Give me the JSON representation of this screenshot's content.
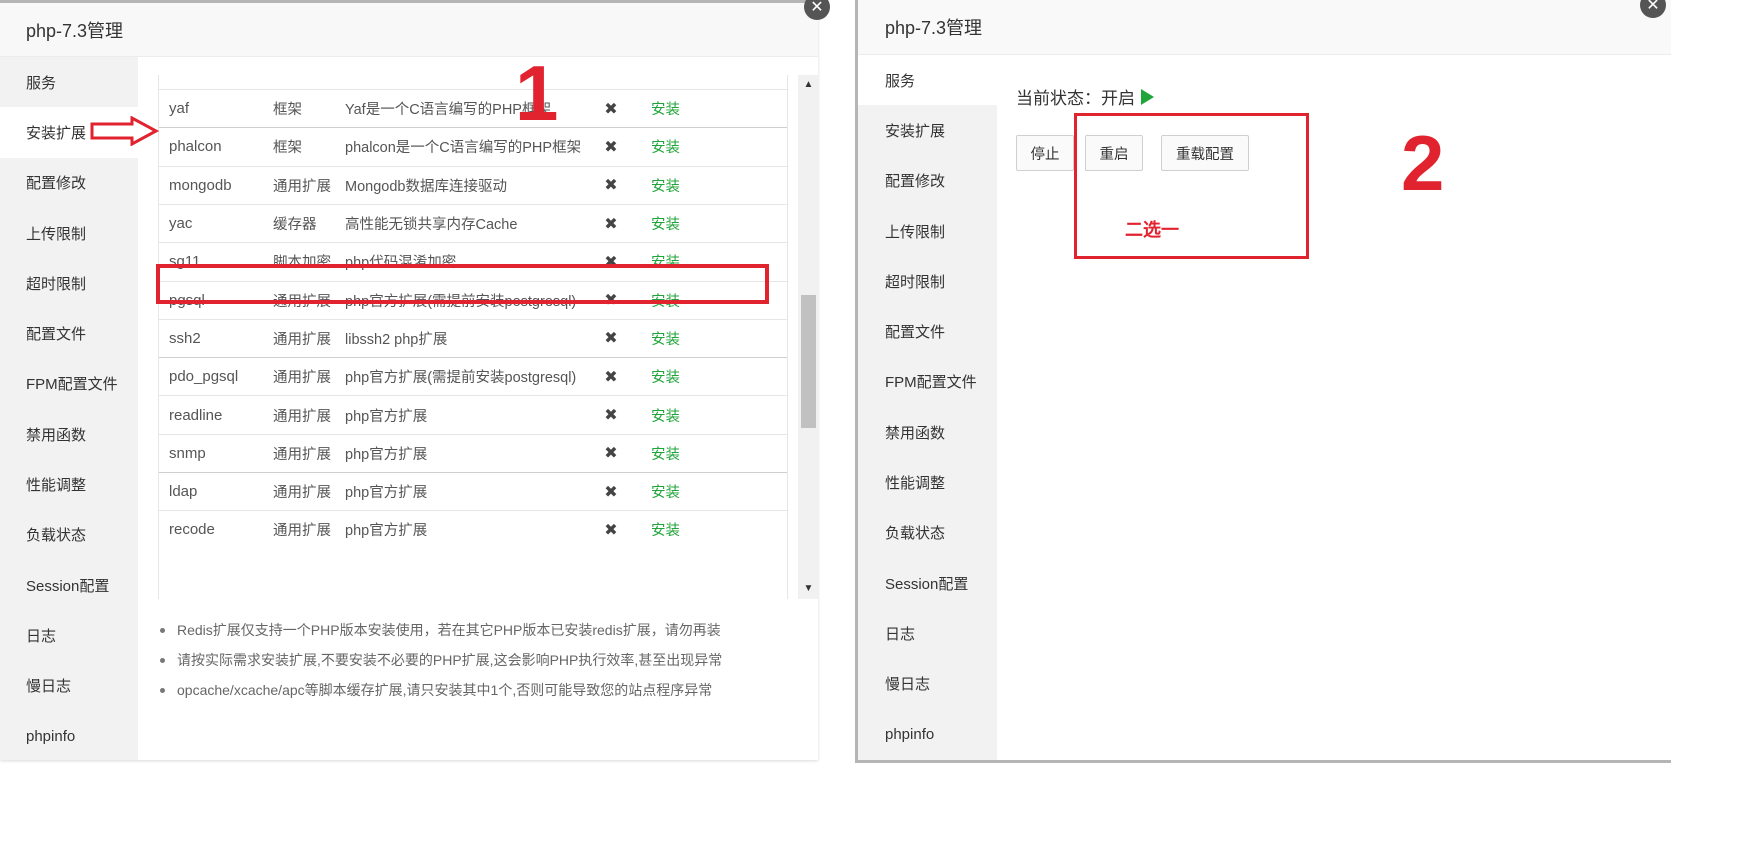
{
  "panel1": {
    "title": "php-7.3管理",
    "close_icon": "close-icon",
    "sidebar": [
      "服务",
      "安装扩展",
      "配置修改",
      "上传限制",
      "超时限制",
      "配置文件",
      "FPM配置文件",
      "禁用函数",
      "性能调整",
      "负载状态",
      "Session配置",
      "日志",
      "慢日志",
      "phpinfo"
    ],
    "active_item": "安装扩展",
    "extensions": [
      {
        "name": "yaf",
        "type": "框架",
        "desc": "Yaf是一个C语言编写的PHP框架",
        "action": "安装"
      },
      {
        "name": "phalcon",
        "type": "框架",
        "desc": "phalcon是一个C语言编写的PHP框架",
        "action": "安装"
      },
      {
        "name": "mongodb",
        "type": "通用扩展",
        "desc": "Mongodb数据库连接驱动",
        "action": "安装"
      },
      {
        "name": "yac",
        "type": "缓存器",
        "desc": "高性能无锁共享内存Cache",
        "action": "安装"
      },
      {
        "name": "sg11",
        "type": "脚本加密",
        "desc": "php代码混淆加密",
        "action": "安装"
      },
      {
        "name": "pgsql",
        "type": "通用扩展",
        "desc": "php官方扩展(需提前安装postgresql)",
        "action": "安装"
      },
      {
        "name": "ssh2",
        "type": "通用扩展",
        "desc": "libssh2 php扩展",
        "action": "安装"
      },
      {
        "name": "pdo_pgsql",
        "type": "通用扩展",
        "desc": "php官方扩展(需提前安装postgresql)",
        "action": "安装"
      },
      {
        "name": "readline",
        "type": "通用扩展",
        "desc": "php官方扩展",
        "action": "安装"
      },
      {
        "name": "snmp",
        "type": "通用扩展",
        "desc": "php官方扩展",
        "action": "安装"
      },
      {
        "name": "ldap",
        "type": "通用扩展",
        "desc": "php官方扩展",
        "action": "安装"
      },
      {
        "name": "recode",
        "type": "通用扩展",
        "desc": "php官方扩展",
        "action": "安装"
      }
    ],
    "uninstalled_mark": "✖",
    "notes": [
      "Redis扩展仅支持一个PHP版本安装使用，若在其它PHP版本已安装redis扩展，请勿再装",
      "请按实际需求安装扩展,不要安装不必要的PHP扩展,这会影响PHP执行效率,甚至出现异常",
      "opcache/xcache/apc等脚本缓存扩展,请只安装其中1个,否则可能导致您的站点程序异常"
    ],
    "annotation_number": "1"
  },
  "panel2": {
    "title": "php-7.3管理",
    "sidebar": [
      "服务",
      "安装扩展",
      "配置修改",
      "上传限制",
      "超时限制",
      "配置文件",
      "FPM配置文件",
      "禁用函数",
      "性能调整",
      "负载状态",
      "Session配置",
      "日志",
      "慢日志",
      "phpinfo"
    ],
    "active_item": "服务",
    "status_label": "当前状态：开启",
    "status_icon": "play-icon",
    "buttons": {
      "stop": "停止",
      "restart": "重启",
      "reload": "重载配置"
    },
    "pick_one_label": "二选一",
    "annotation_number": "2"
  },
  "colors": {
    "accent_red": "#e1232f",
    "install_green": "#20a53a"
  }
}
